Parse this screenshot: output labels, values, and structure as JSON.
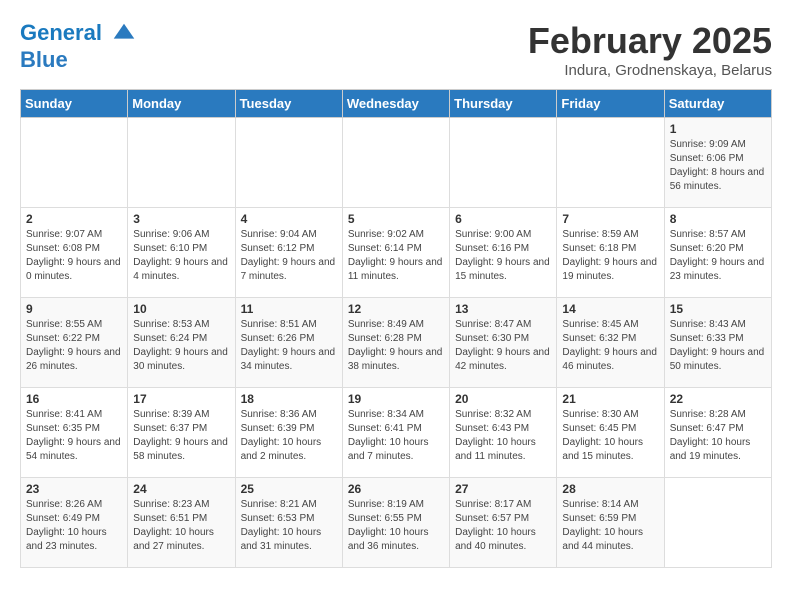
{
  "header": {
    "logo_line1": "General",
    "logo_line2": "Blue",
    "month": "February 2025",
    "location": "Indura, Grodnenskaya, Belarus"
  },
  "days_of_week": [
    "Sunday",
    "Monday",
    "Tuesday",
    "Wednesday",
    "Thursday",
    "Friday",
    "Saturday"
  ],
  "weeks": [
    [
      {
        "day": "",
        "content": ""
      },
      {
        "day": "",
        "content": ""
      },
      {
        "day": "",
        "content": ""
      },
      {
        "day": "",
        "content": ""
      },
      {
        "day": "",
        "content": ""
      },
      {
        "day": "",
        "content": ""
      },
      {
        "day": "1",
        "content": "Sunrise: 9:09 AM\nSunset: 6:06 PM\nDaylight: 8 hours and 56 minutes."
      }
    ],
    [
      {
        "day": "2",
        "content": "Sunrise: 9:07 AM\nSunset: 6:08 PM\nDaylight: 9 hours and 0 minutes."
      },
      {
        "day": "3",
        "content": "Sunrise: 9:06 AM\nSunset: 6:10 PM\nDaylight: 9 hours and 4 minutes."
      },
      {
        "day": "4",
        "content": "Sunrise: 9:04 AM\nSunset: 6:12 PM\nDaylight: 9 hours and 7 minutes."
      },
      {
        "day": "5",
        "content": "Sunrise: 9:02 AM\nSunset: 6:14 PM\nDaylight: 9 hours and 11 minutes."
      },
      {
        "day": "6",
        "content": "Sunrise: 9:00 AM\nSunset: 6:16 PM\nDaylight: 9 hours and 15 minutes."
      },
      {
        "day": "7",
        "content": "Sunrise: 8:59 AM\nSunset: 6:18 PM\nDaylight: 9 hours and 19 minutes."
      },
      {
        "day": "8",
        "content": "Sunrise: 8:57 AM\nSunset: 6:20 PM\nDaylight: 9 hours and 23 minutes."
      }
    ],
    [
      {
        "day": "9",
        "content": "Sunrise: 8:55 AM\nSunset: 6:22 PM\nDaylight: 9 hours and 26 minutes."
      },
      {
        "day": "10",
        "content": "Sunrise: 8:53 AM\nSunset: 6:24 PM\nDaylight: 9 hours and 30 minutes."
      },
      {
        "day": "11",
        "content": "Sunrise: 8:51 AM\nSunset: 6:26 PM\nDaylight: 9 hours and 34 minutes."
      },
      {
        "day": "12",
        "content": "Sunrise: 8:49 AM\nSunset: 6:28 PM\nDaylight: 9 hours and 38 minutes."
      },
      {
        "day": "13",
        "content": "Sunrise: 8:47 AM\nSunset: 6:30 PM\nDaylight: 9 hours and 42 minutes."
      },
      {
        "day": "14",
        "content": "Sunrise: 8:45 AM\nSunset: 6:32 PM\nDaylight: 9 hours and 46 minutes."
      },
      {
        "day": "15",
        "content": "Sunrise: 8:43 AM\nSunset: 6:33 PM\nDaylight: 9 hours and 50 minutes."
      }
    ],
    [
      {
        "day": "16",
        "content": "Sunrise: 8:41 AM\nSunset: 6:35 PM\nDaylight: 9 hours and 54 minutes."
      },
      {
        "day": "17",
        "content": "Sunrise: 8:39 AM\nSunset: 6:37 PM\nDaylight: 9 hours and 58 minutes."
      },
      {
        "day": "18",
        "content": "Sunrise: 8:36 AM\nSunset: 6:39 PM\nDaylight: 10 hours and 2 minutes."
      },
      {
        "day": "19",
        "content": "Sunrise: 8:34 AM\nSunset: 6:41 PM\nDaylight: 10 hours and 7 minutes."
      },
      {
        "day": "20",
        "content": "Sunrise: 8:32 AM\nSunset: 6:43 PM\nDaylight: 10 hours and 11 minutes."
      },
      {
        "day": "21",
        "content": "Sunrise: 8:30 AM\nSunset: 6:45 PM\nDaylight: 10 hours and 15 minutes."
      },
      {
        "day": "22",
        "content": "Sunrise: 8:28 AM\nSunset: 6:47 PM\nDaylight: 10 hours and 19 minutes."
      }
    ],
    [
      {
        "day": "23",
        "content": "Sunrise: 8:26 AM\nSunset: 6:49 PM\nDaylight: 10 hours and 23 minutes."
      },
      {
        "day": "24",
        "content": "Sunrise: 8:23 AM\nSunset: 6:51 PM\nDaylight: 10 hours and 27 minutes."
      },
      {
        "day": "25",
        "content": "Sunrise: 8:21 AM\nSunset: 6:53 PM\nDaylight: 10 hours and 31 minutes."
      },
      {
        "day": "26",
        "content": "Sunrise: 8:19 AM\nSunset: 6:55 PM\nDaylight: 10 hours and 36 minutes."
      },
      {
        "day": "27",
        "content": "Sunrise: 8:17 AM\nSunset: 6:57 PM\nDaylight: 10 hours and 40 minutes."
      },
      {
        "day": "28",
        "content": "Sunrise: 8:14 AM\nSunset: 6:59 PM\nDaylight: 10 hours and 44 minutes."
      },
      {
        "day": "",
        "content": ""
      }
    ]
  ]
}
